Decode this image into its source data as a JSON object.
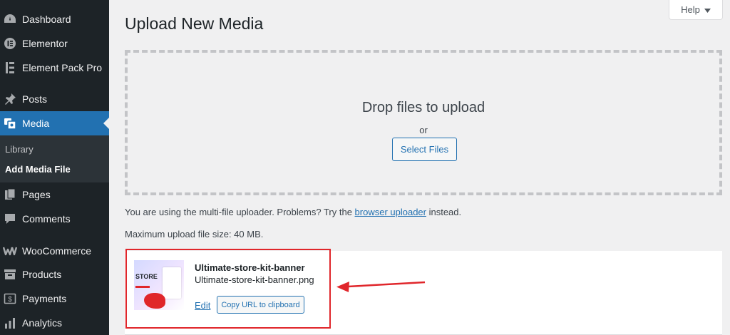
{
  "sidebar": {
    "items": [
      {
        "label": "Dashboard",
        "icon": "dashboard-icon"
      },
      {
        "label": "Elementor",
        "icon": "elementor-icon"
      },
      {
        "label": "Element Pack Pro",
        "icon": "element-pack-icon"
      },
      {
        "label": "Posts",
        "icon": "pin-icon"
      },
      {
        "label": "Media",
        "icon": "media-icon"
      },
      {
        "label": "Pages",
        "icon": "pages-icon"
      },
      {
        "label": "Comments",
        "icon": "comments-icon"
      },
      {
        "label": "WooCommerce",
        "icon": "woocommerce-icon"
      },
      {
        "label": "Products",
        "icon": "products-icon"
      },
      {
        "label": "Payments",
        "icon": "payments-icon"
      },
      {
        "label": "Analytics",
        "icon": "analytics-icon"
      }
    ],
    "submenu": [
      {
        "label": "Library"
      },
      {
        "label": "Add Media File"
      }
    ]
  },
  "header": {
    "help_label": "Help",
    "title": "Upload New Media"
  },
  "upload": {
    "drop_title": "Drop files to upload",
    "or_label": "or",
    "select_label": "Select Files",
    "note_before": "You are using the multi-file uploader. Problems? Try the ",
    "note_link": "browser uploader",
    "note_after": " instead.",
    "max_size": "Maximum upload file size: 40 MB."
  },
  "media_item": {
    "title": "Ultimate-store-kit-banner",
    "filename": "Ultimate-store-kit-banner.png",
    "edit_label": "Edit",
    "copy_label": "Copy URL to clipboard",
    "thumb_text": "STORE"
  },
  "colors": {
    "accent": "#2271b1",
    "sidebar_bg": "#1d2327",
    "highlight": "#e0262b"
  }
}
